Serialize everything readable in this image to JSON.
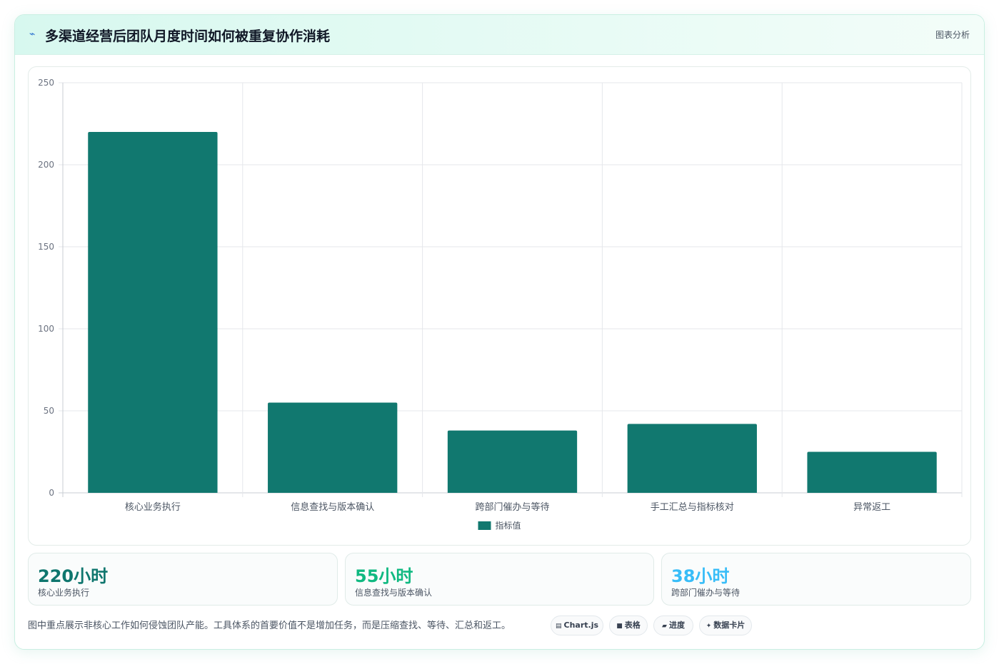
{
  "header": {
    "title": "多渠道经营后团队月度时间如何被重复协作消耗",
    "right_label": "图表分析",
    "icon": "trend-line-icon"
  },
  "chart_data": {
    "type": "bar",
    "categories": [
      "核心业务执行",
      "信息查找与版本确认",
      "跨部门催办与等待",
      "手工汇总与指标核对",
      "异常返工"
    ],
    "series": [
      {
        "name": "指标值",
        "values": [
          220,
          55,
          38,
          42,
          25
        ],
        "color": "#11786f"
      }
    ],
    "y_ticks": [
      "0",
      "50",
      "100",
      "150",
      "200",
      "250"
    ],
    "ylim": [
      0,
      250
    ],
    "grid": true,
    "legend_position": "bottom"
  },
  "stats": [
    {
      "value": "220小时",
      "label": "核心业务执行",
      "color": "#0f766e"
    },
    {
      "value": "55小时",
      "label": "信息查找与版本确认",
      "color": "#10b981"
    },
    {
      "value": "38小时",
      "label": "跨部门催办与等待",
      "color": "#38bdf8"
    }
  ],
  "note": "图中重点展示非核心工作如何侵蚀团队产能。工具体系的首要价值不是增加任务，而是压缩查找、等待、汇总和返工。",
  "chips": [
    {
      "icon": "chart-icon",
      "glyph": "▤",
      "label": "Chart.js"
    },
    {
      "icon": "table-icon",
      "glyph": "■",
      "label": "表格"
    },
    {
      "icon": "progress-icon",
      "glyph": "▰",
      "label": "进度"
    },
    {
      "icon": "sparkle-icon",
      "glyph": "✦",
      "label": "数据卡片"
    }
  ]
}
